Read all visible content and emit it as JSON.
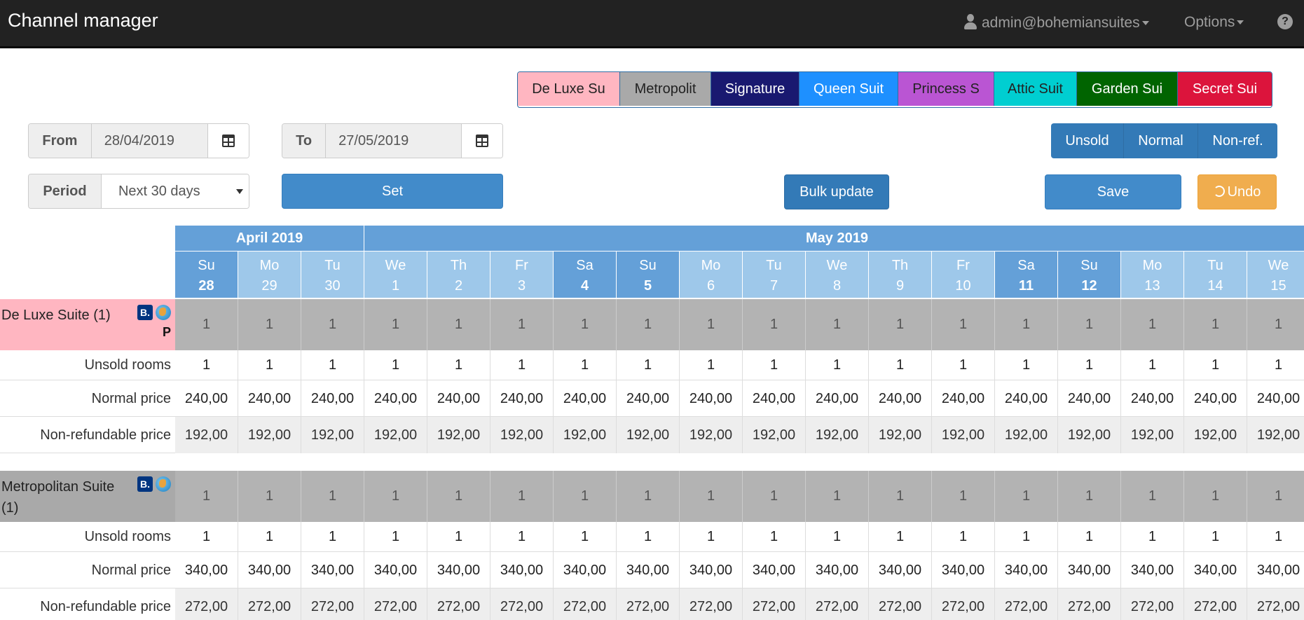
{
  "app": {
    "title": "Channel manager"
  },
  "nav": {
    "user": "admin@bohemiansuites",
    "options": "Options",
    "help": "?"
  },
  "room_tabs": [
    {
      "label": "De Luxe Su",
      "bg": "#ffb6c1",
      "fg": "#222222"
    },
    {
      "label": "Metropolit",
      "bg": "#a9a9a9",
      "fg": "#222222"
    },
    {
      "label": "Signature",
      "bg": "#191970",
      "fg": "#ffffff"
    },
    {
      "label": "Queen Suit",
      "bg": "#1e90ff",
      "fg": "#ffffff"
    },
    {
      "label": "Princess S",
      "bg": "#ba55d3",
      "fg": "#222222"
    },
    {
      "label": "Attic Suit",
      "bg": "#00ced1",
      "fg": "#222222"
    },
    {
      "label": "Garden Sui",
      "bg": "#006400",
      "fg": "#ffffff"
    },
    {
      "label": "Secret Sui",
      "bg": "#dc143c",
      "fg": "#ffffff"
    }
  ],
  "filters": {
    "from_label": "From",
    "from_value": "28/04/2019",
    "to_label": "To",
    "to_value": "27/05/2019",
    "period_label": "Period",
    "period_value": "Next 30 days"
  },
  "view_toggle": [
    "Unsold",
    "Normal",
    "Non-ref."
  ],
  "buttons": {
    "set": "Set",
    "bulk_update": "Bulk update",
    "save": "Save",
    "undo": "Undo"
  },
  "months": [
    {
      "label": "April 2019",
      "span": 3
    },
    {
      "label": "May 2019",
      "span": 15
    }
  ],
  "days": [
    {
      "dow": "Su",
      "num": "28",
      "weekend": true
    },
    {
      "dow": "Mo",
      "num": "29",
      "weekend": false
    },
    {
      "dow": "Tu",
      "num": "30",
      "weekend": false
    },
    {
      "dow": "We",
      "num": "1",
      "weekend": false
    },
    {
      "dow": "Th",
      "num": "2",
      "weekend": false
    },
    {
      "dow": "Fr",
      "num": "3",
      "weekend": false
    },
    {
      "dow": "Sa",
      "num": "4",
      "weekend": true
    },
    {
      "dow": "Su",
      "num": "5",
      "weekend": true
    },
    {
      "dow": "Mo",
      "num": "6",
      "weekend": false
    },
    {
      "dow": "Tu",
      "num": "7",
      "weekend": false
    },
    {
      "dow": "We",
      "num": "8",
      "weekend": false
    },
    {
      "dow": "Th",
      "num": "9",
      "weekend": false
    },
    {
      "dow": "Fr",
      "num": "10",
      "weekend": false
    },
    {
      "dow": "Sa",
      "num": "11",
      "weekend": true
    },
    {
      "dow": "Su",
      "num": "12",
      "weekend": true
    },
    {
      "dow": "Mo",
      "num": "13",
      "weekend": false
    },
    {
      "dow": "Tu",
      "num": "14",
      "weekend": false
    },
    {
      "dow": "We",
      "num": "15",
      "weekend": false
    }
  ],
  "rooms": [
    {
      "name": "De Luxe Suite (1)",
      "color": "#ffb6c1",
      "badge_p": "P",
      "availability": "1",
      "rows": [
        {
          "label": "Unsold rooms",
          "value": "1",
          "style": "white"
        },
        {
          "label": "Normal price",
          "value": "240,00",
          "style": "white"
        },
        {
          "label": "Non-refundable price",
          "value": "192,00",
          "style": "light"
        }
      ]
    },
    {
      "name": "Metropolitan Suite (1)",
      "color": "#a9a9a9",
      "badge_p": "",
      "availability": "1",
      "rows": [
        {
          "label": "Unsold rooms",
          "value": "1",
          "style": "white"
        },
        {
          "label": "Normal price",
          "value": "340,00",
          "style": "white"
        },
        {
          "label": "Non-refundable price",
          "value": "272,00",
          "style": "light"
        }
      ]
    }
  ]
}
